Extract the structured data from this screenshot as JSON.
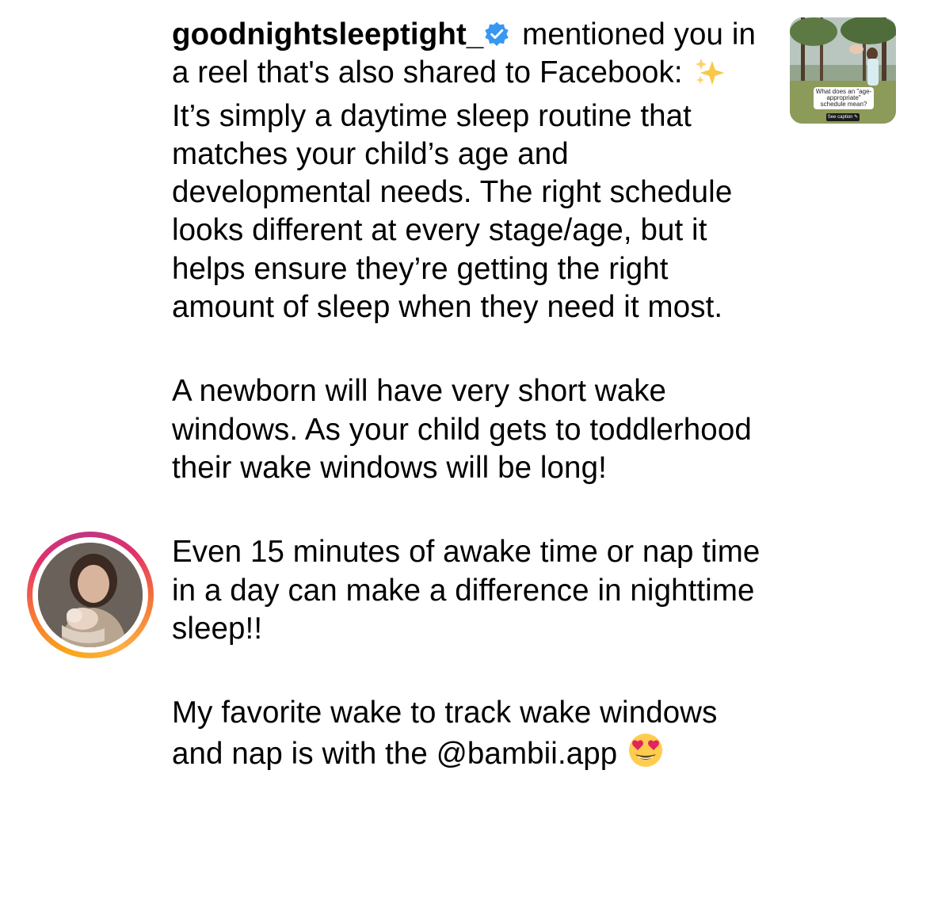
{
  "notification": {
    "username": "goodnightsleeptight_",
    "verified_icon": "verified-badge-icon",
    "intro_text": " mentioned you in a reel that's also shared to Facebook: ",
    "sparkles_emoji": "✨",
    "paragraphs": [
      " It’s simply a daytime sleep routine that matches your child’s age and developmental needs. The right schedule looks different at every stage/age, but it helps ensure they’re getting the right amount of sleep when they need it most.",
      "A newborn will have very short wake windows. As your child gets to toddlerhood their wake windows will be long!",
      "Even 15 minutes of awake time or nap time in a day can make a difference in nighttime sleep!!",
      "My favorite wake to track wake windows and nap is with the @bambii.app "
    ],
    "heart_eyes_emoji": "😍",
    "avatar_icon": "profile-avatar",
    "story_ring_colors": [
      "#f9a71a",
      "#f77737",
      "#e1306c",
      "#c13584",
      "#fcaf45"
    ],
    "thumbnail": {
      "caption": "What does an \"age-appropriate\" schedule mean?",
      "pill": "See caption ✎"
    }
  }
}
